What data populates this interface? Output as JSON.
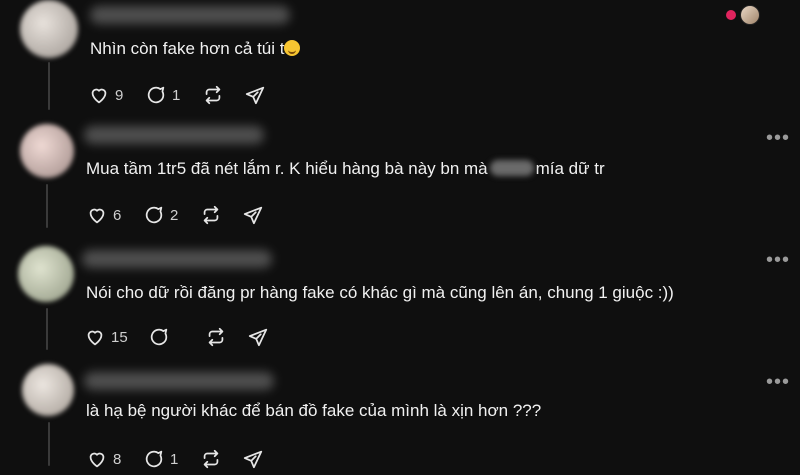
{
  "posts": [
    {
      "text": "Nhìn còn fake hơn cả túi t",
      "emoji": "rofl-emoji",
      "likes": "9",
      "replies": "1",
      "reposts": "",
      "shares": "",
      "avatar_color": "#cfc8c2"
    },
    {
      "text_before": "Mua tầm 1tr5 đã nét lắm r. K hiểu hàng bà này bn mà",
      "text_after": "mía dữ tr",
      "likes": "6",
      "replies": "2",
      "avatar_color": "#d8c4c0"
    },
    {
      "text": "Nói cho dữ rồi đăng pr hàng fake có khác gì mà cũng lên án, chung 1 giuộc :))",
      "likes": "15",
      "replies": "",
      "avatar_color": "#c9cfb8"
    },
    {
      "text": "là hạ bệ người khác để bán đồ fake của mình là xịn hơn ???",
      "likes": "8",
      "replies": "1",
      "avatar_color": "#d9d2cc"
    }
  ],
  "colors": {
    "background": "#0f0f0f",
    "text": "#f1f1f1",
    "icon": "#e6e6e6",
    "reaction": "#e0245e"
  },
  "more_label": "•••"
}
